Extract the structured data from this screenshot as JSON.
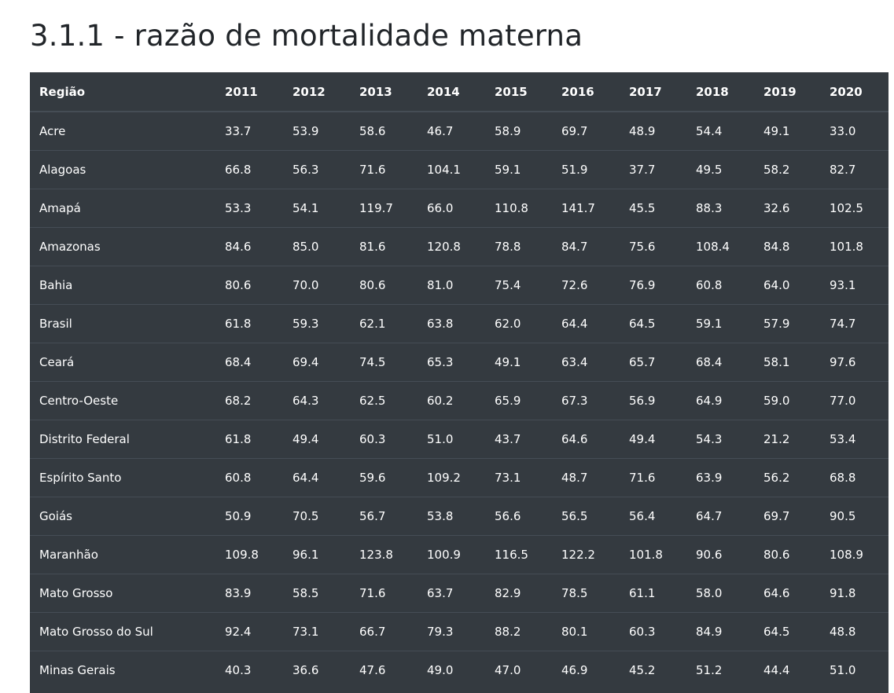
{
  "page": {
    "title": "3.1.1 - razão de mortalidade materna"
  },
  "table": {
    "columns": [
      "Região",
      "2011",
      "2012",
      "2013",
      "2014",
      "2015",
      "2016",
      "2017",
      "2018",
      "2019",
      "2020"
    ],
    "rows": [
      [
        "Acre",
        "33.7",
        "53.9",
        "58.6",
        "46.7",
        "58.9",
        "69.7",
        "48.9",
        "54.4",
        "49.1",
        "33.0"
      ],
      [
        "Alagoas",
        "66.8",
        "56.3",
        "71.6",
        "104.1",
        "59.1",
        "51.9",
        "37.7",
        "49.5",
        "58.2",
        "82.7"
      ],
      [
        "Amapá",
        "53.3",
        "54.1",
        "119.7",
        "66.0",
        "110.8",
        "141.7",
        "45.5",
        "88.3",
        "32.6",
        "102.5"
      ],
      [
        "Amazonas",
        "84.6",
        "85.0",
        "81.6",
        "120.8",
        "78.8",
        "84.7",
        "75.6",
        "108.4",
        "84.8",
        "101.8"
      ],
      [
        "Bahia",
        "80.6",
        "70.0",
        "80.6",
        "81.0",
        "75.4",
        "72.6",
        "76.9",
        "60.8",
        "64.0",
        "93.1"
      ],
      [
        "Brasil",
        "61.8",
        "59.3",
        "62.1",
        "63.8",
        "62.0",
        "64.4",
        "64.5",
        "59.1",
        "57.9",
        "74.7"
      ],
      [
        "Ceará",
        "68.4",
        "69.4",
        "74.5",
        "65.3",
        "49.1",
        "63.4",
        "65.7",
        "68.4",
        "58.1",
        "97.6"
      ],
      [
        "Centro-Oeste",
        "68.2",
        "64.3",
        "62.5",
        "60.2",
        "65.9",
        "67.3",
        "56.9",
        "64.9",
        "59.0",
        "77.0"
      ],
      [
        "Distrito Federal",
        "61.8",
        "49.4",
        "60.3",
        "51.0",
        "43.7",
        "64.6",
        "49.4",
        "54.3",
        "21.2",
        "53.4"
      ],
      [
        "Espírito Santo",
        "60.8",
        "64.4",
        "59.6",
        "109.2",
        "73.1",
        "48.7",
        "71.6",
        "63.9",
        "56.2",
        "68.8"
      ],
      [
        "Goiás",
        "50.9",
        "70.5",
        "56.7",
        "53.8",
        "56.6",
        "56.5",
        "56.4",
        "64.7",
        "69.7",
        "90.5"
      ],
      [
        "Maranhão",
        "109.8",
        "96.1",
        "123.8",
        "100.9",
        "116.5",
        "122.2",
        "101.8",
        "90.6",
        "80.6",
        "108.9"
      ],
      [
        "Mato Grosso",
        "83.9",
        "58.5",
        "71.6",
        "63.7",
        "82.9",
        "78.5",
        "61.1",
        "58.0",
        "64.6",
        "91.8"
      ],
      [
        "Mato Grosso do Sul",
        "92.4",
        "73.1",
        "66.7",
        "79.3",
        "88.2",
        "80.1",
        "60.3",
        "84.9",
        "64.5",
        "48.8"
      ],
      [
        "Minas Gerais",
        "40.3",
        "36.6",
        "47.6",
        "49.0",
        "47.0",
        "46.9",
        "45.2",
        "51.2",
        "44.4",
        "51.0"
      ]
    ]
  }
}
